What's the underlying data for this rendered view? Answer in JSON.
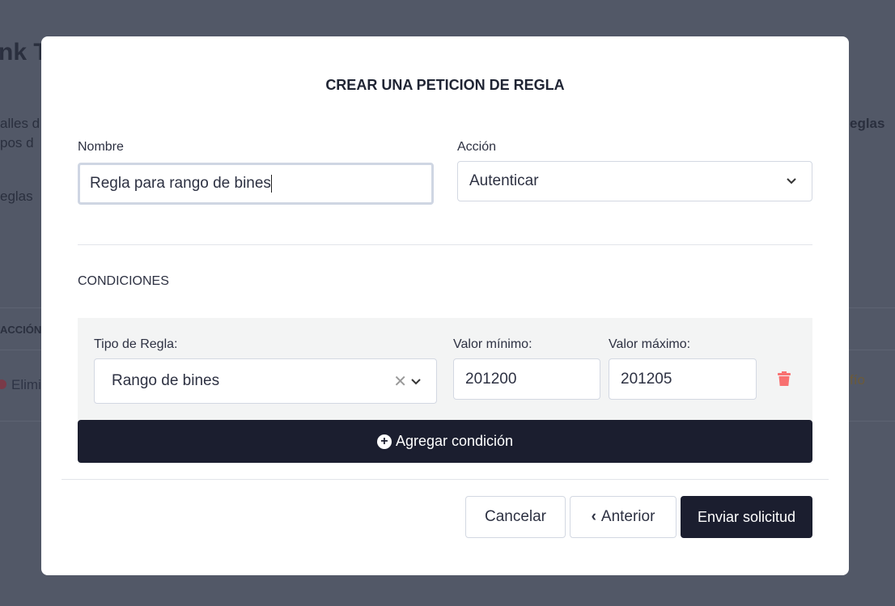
{
  "background": {
    "title_fragment": "nk T",
    "line1": "alles d",
    "line2": "pos d",
    "line3": "eglas",
    "right_fragment": "eglas",
    "column_fragment": "ACCIÓN",
    "delete_fragment": "Elimi",
    "status_fragment": "fío"
  },
  "modal": {
    "title": "CREAR UNA PETICION DE REGLA",
    "name_label": "Nombre",
    "name_value": "Regla para rango de bines",
    "action_label": "Acción",
    "action_value": "Autenticar",
    "conditions_heading": "CONDICIONES",
    "condition": {
      "type_label": "Tipo de Regla:",
      "type_value": "Rango de bines",
      "min_label": "Valor mínimo:",
      "min_value": "201200",
      "max_label": "Valor máximo:",
      "max_value": "201205"
    },
    "add_condition": "Agregar condición",
    "cancel": "Cancelar",
    "previous": "Anterior",
    "submit": "Enviar solicitud"
  },
  "colors": {
    "dark": "#1b1e2f",
    "danger": "#f87171",
    "overlay": "#525867"
  }
}
